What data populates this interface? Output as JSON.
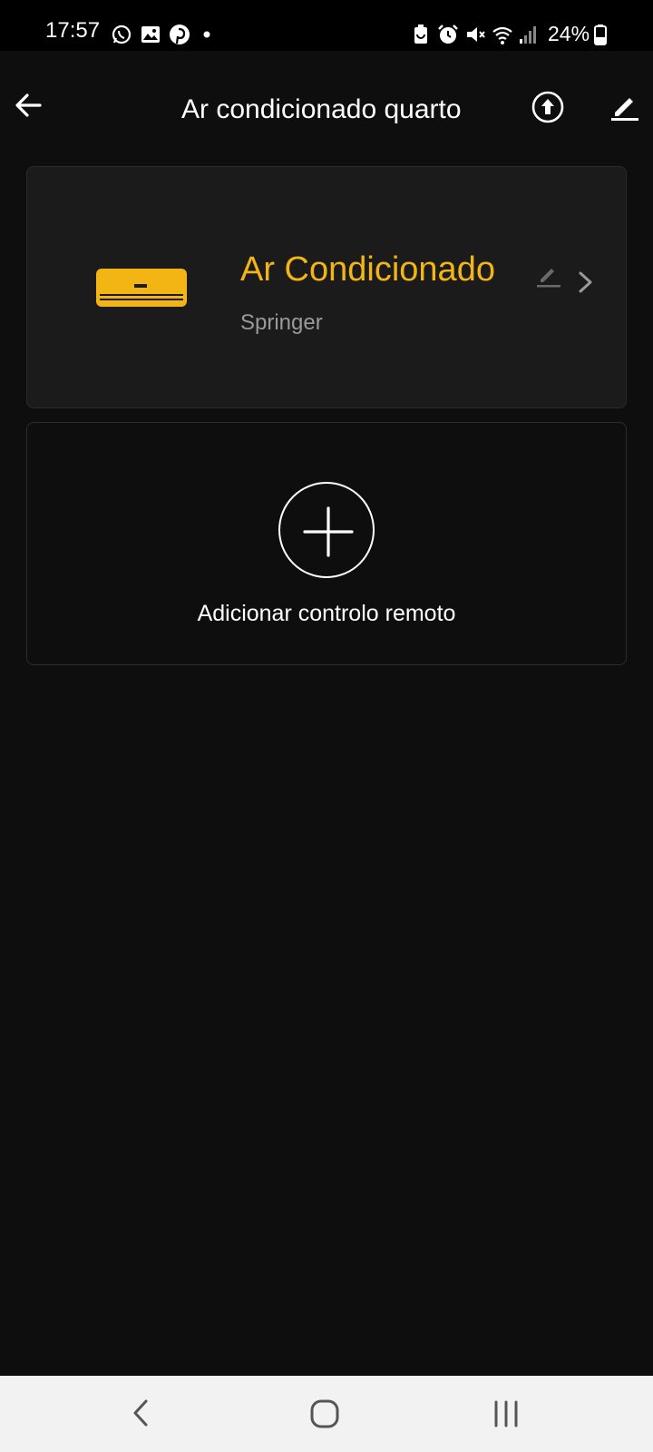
{
  "status_bar": {
    "time": "17:57",
    "battery_percent": "24%",
    "left_icons": [
      "whatsapp-icon",
      "gallery-icon",
      "pinterest-icon",
      "dot-icon"
    ],
    "right_icons": [
      "battery-saver-icon",
      "alarm-icon",
      "mute-icon",
      "wifi-icon",
      "signal-icon",
      "battery-icon"
    ]
  },
  "header": {
    "title": "Ar condicionado quarto",
    "back_icon": "arrow-left-icon",
    "upload_icon": "upload-circle-icon",
    "edit_icon": "pencil-icon"
  },
  "device": {
    "name": "Ar Condicionado",
    "brand": "Springer",
    "icon": "air-conditioner-icon",
    "accent_color": "#f2b514"
  },
  "add_remote": {
    "label": "Adicionar controlo remoto",
    "icon": "plus-icon"
  },
  "nav_bar": {
    "icons": [
      "nav-back-icon",
      "nav-home-icon",
      "nav-recents-icon"
    ]
  }
}
